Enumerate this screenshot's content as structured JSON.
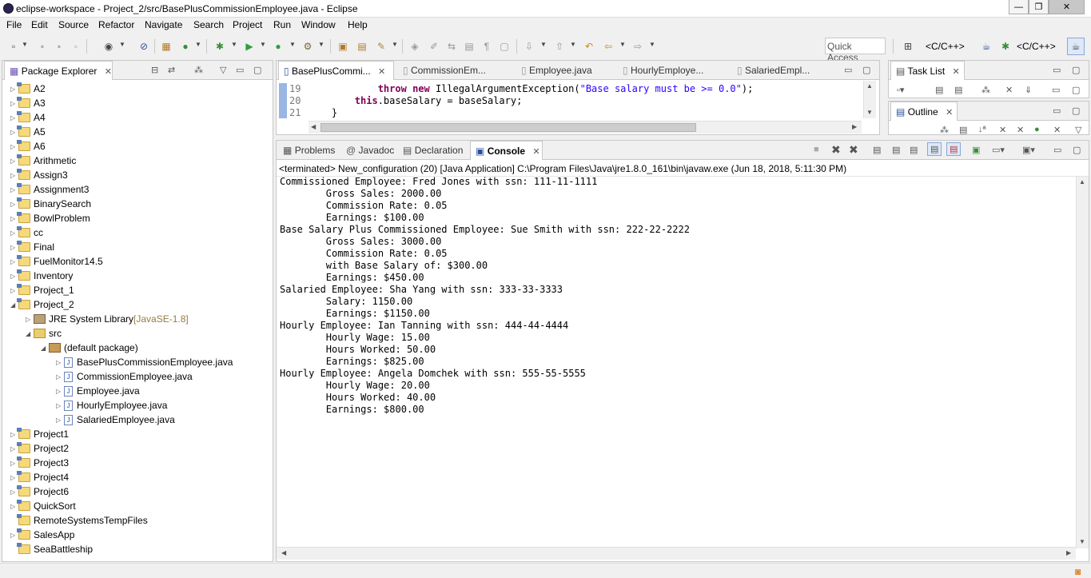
{
  "window": {
    "title": "eclipse-workspace - Project_2/src/BasePlusCommissionEmployee.java - Eclipse",
    "minimize": "—",
    "maximize": "❐",
    "close": "✕"
  },
  "menu": [
    "File",
    "Edit",
    "Source",
    "Refactor",
    "Navigate",
    "Search",
    "Project",
    "Run",
    "Window",
    "Help"
  ],
  "toolbar": {
    "quick_access": "Quick Access",
    "perspective1": "<C/C++>",
    "perspective2": "<C/C++>"
  },
  "package_explorer": {
    "title": "Package Explorer",
    "items": [
      {
        "label": "A2",
        "level": 0,
        "expanded": false
      },
      {
        "label": "A3",
        "level": 0,
        "expanded": false
      },
      {
        "label": "A4",
        "level": 0,
        "expanded": false
      },
      {
        "label": "A5",
        "level": 0,
        "expanded": false
      },
      {
        "label": "A6",
        "level": 0,
        "expanded": false
      },
      {
        "label": "Arithmetic",
        "level": 0,
        "expanded": false
      },
      {
        "label": "Assign3",
        "level": 0,
        "expanded": false
      },
      {
        "label": "Assignment3",
        "level": 0,
        "expanded": false
      },
      {
        "label": "BinarySearch",
        "level": 0,
        "expanded": false
      },
      {
        "label": "BowlProblem",
        "level": 0,
        "expanded": false
      },
      {
        "label": "cc",
        "level": 0,
        "expanded": false
      },
      {
        "label": "Final",
        "level": 0,
        "expanded": false
      },
      {
        "label": "FuelMonitor14.5",
        "level": 0,
        "expanded": false
      },
      {
        "label": "Inventory",
        "level": 0,
        "expanded": false
      },
      {
        "label": "Project_1",
        "level": 0,
        "expanded": false
      },
      {
        "label": "Project_2",
        "level": 0,
        "expanded": true
      },
      {
        "label": "JRE System Library",
        "suffix": "[JavaSE-1.8]",
        "level": 1,
        "expanded": false,
        "kind": "lib"
      },
      {
        "label": "src",
        "level": 1,
        "expanded": true,
        "kind": "src"
      },
      {
        "label": "(default package)",
        "level": 2,
        "expanded": true,
        "kind": "pkg"
      },
      {
        "label": "BasePlusCommissionEmployee.java",
        "level": 3,
        "expanded": false,
        "kind": "java"
      },
      {
        "label": "CommissionEmployee.java",
        "level": 3,
        "expanded": false,
        "kind": "java"
      },
      {
        "label": "Employee.java",
        "level": 3,
        "expanded": false,
        "kind": "java"
      },
      {
        "label": "HourlyEmployee.java",
        "level": 3,
        "expanded": false,
        "kind": "java"
      },
      {
        "label": "SalariedEmployee.java",
        "level": 3,
        "expanded": false,
        "kind": "java"
      },
      {
        "label": "Project1",
        "level": 0,
        "expanded": false
      },
      {
        "label": "Project2",
        "level": 0,
        "expanded": false
      },
      {
        "label": "Project3",
        "level": 0,
        "expanded": false
      },
      {
        "label": "Project4",
        "level": 0,
        "expanded": false
      },
      {
        "label": "Project6",
        "level": 0,
        "expanded": false
      },
      {
        "label": "QuickSort",
        "level": 0,
        "expanded": false
      },
      {
        "label": "RemoteSystemsTempFiles",
        "level": 0,
        "expanded": false,
        "noarrow": true
      },
      {
        "label": "SalesApp",
        "level": 0,
        "expanded": false
      },
      {
        "label": "SeaBattleship",
        "level": 0,
        "expanded": false,
        "noarrow": true
      }
    ]
  },
  "editor": {
    "tabs": [
      "BasePlusCommi...",
      "CommissionEm...",
      "Employee.java",
      "HourlyEmploye...",
      "SalariedEmpl..."
    ],
    "lines": [
      {
        "num": "19",
        "parts": [
          {
            "t": "            ",
            "c": ""
          },
          {
            "t": "throw",
            "c": "kw"
          },
          {
            "t": " ",
            "c": ""
          },
          {
            "t": "new",
            "c": "kw"
          },
          {
            "t": " IllegalArgumentException(",
            "c": ""
          },
          {
            "t": "\"Base salary must be >= 0.0\"",
            "c": "str"
          },
          {
            "t": ");",
            "c": ""
          }
        ]
      },
      {
        "num": "20",
        "parts": [
          {
            "t": "        ",
            "c": ""
          },
          {
            "t": "this",
            "c": "kw"
          },
          {
            "t": ".baseSalary = baseSalary;",
            "c": ""
          }
        ]
      },
      {
        "num": "21",
        "parts": [
          {
            "t": "    }",
            "c": ""
          }
        ]
      }
    ]
  },
  "task_list": {
    "title": "Task List"
  },
  "outline": {
    "title": "Outline"
  },
  "console": {
    "tabs": [
      "Problems",
      "Javadoc",
      "Declaration",
      "Console"
    ],
    "status": "<terminated> New_configuration (20) [Java Application] C:\\Program Files\\Java\\jre1.8.0_161\\bin\\javaw.exe (Jun 18, 2018, 5:11:30 PM)",
    "lines": [
      "Commissioned Employee: Fred Jones with ssn: 111-11-1111",
      "        Gross Sales: 2000.00",
      "        Commission Rate: 0.05",
      "        Earnings: $100.00",
      "Base Salary Plus Commissioned Employee: Sue Smith with ssn: 222-22-2222",
      "        Gross Sales: 3000.00",
      "        Commission Rate: 0.05",
      "        with Base Salary of: $300.00",
      "        Earnings: $450.00",
      "Salaried Employee: Sha Yang with ssn: 333-33-3333",
      "        Salary: 1150.00",
      "        Earnings: $1150.00",
      "Hourly Employee: Ian Tanning with ssn: 444-44-4444",
      "        Hourly Wage: 15.00",
      "        Hours Worked: 50.00",
      "        Earnings: $825.00",
      "Hourly Employee: Angela Domchek with ssn: 555-55-5555",
      "        Hourly Wage: 20.00",
      "        Hours Worked: 40.00",
      "        Earnings: $800.00"
    ]
  }
}
